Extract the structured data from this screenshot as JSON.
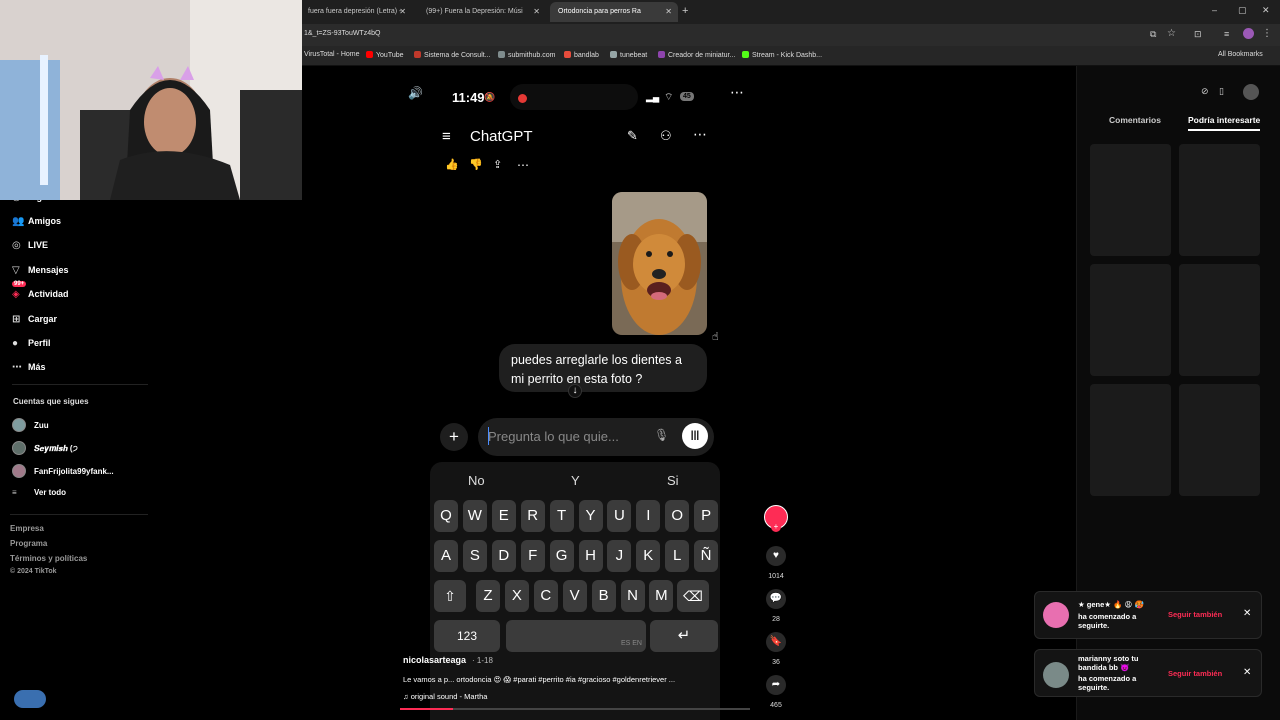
{
  "browser": {
    "tabs": [
      {
        "label": "fuera fuera depresión (Letra) -"
      },
      {
        "label": "(99+) Fuera la Depresión: Músi"
      },
      {
        "label": "Ortodoncia para perros Ra"
      }
    ],
    "url": "1&_t=ZS-93TouWTz4bQ",
    "bookmarks": [
      "VirusTotal - Home",
      "YouTube",
      "Sistema de Consult...",
      "submithub.com",
      "bandlab",
      "tunebeat",
      "Creador de miniatur...",
      "Stream - Kick Dashb..."
    ],
    "all_bookmarks": "All Bookmarks"
  },
  "sidebar": {
    "items": [
      {
        "label": "Siguiendo",
        "icon": "following-icon"
      },
      {
        "label": "Amigos",
        "icon": "friends-icon"
      },
      {
        "label": "LIVE",
        "icon": "live-icon"
      },
      {
        "label": "Mensajes",
        "icon": "messages-icon"
      },
      {
        "label": "Actividad",
        "icon": "activity-icon",
        "badge": "99+"
      },
      {
        "label": "Cargar",
        "icon": "upload-icon"
      },
      {
        "label": "Perfil",
        "icon": "profile-icon"
      },
      {
        "label": "Más",
        "icon": "more-icon"
      }
    ],
    "following_title": "Cuentas que sigues",
    "following": [
      "Zuu",
      "𝑺𝒆𝒚𝒎𝒊𝒔𝒉 (੭",
      "FanFrijolita99yfank..."
    ],
    "see_all": "Ver todo",
    "footer": [
      "Empresa",
      "Programa",
      "Términos y políticas",
      "© 2024 TikTok"
    ]
  },
  "phone": {
    "time": "11:49",
    "battery": "45",
    "app_title": "ChatGPT",
    "message": "puedes arreglarle los dientes a mi perrito en esta foto ?",
    "input_placeholder": "Pregunta lo que quie...",
    "suggestions": [
      "No",
      "Y",
      "Si"
    ],
    "keys_row1": [
      "Q",
      "W",
      "E",
      "R",
      "T",
      "Y",
      "U",
      "I",
      "O",
      "P"
    ],
    "keys_row2": [
      "A",
      "S",
      "D",
      "F",
      "G",
      "H",
      "J",
      "K",
      "L",
      "Ñ"
    ],
    "keys_row3": [
      "Z",
      "X",
      "C",
      "V",
      "B",
      "N",
      "M"
    ],
    "numbers_key": "123",
    "lang": "ES EN"
  },
  "video": {
    "author": "nicolasarteaga",
    "date": "1-18",
    "caption": "Le vamos a p... ortodoncia 😍 😱 #parati #perrito #ia #gracioso #goldenretriever ...",
    "sound": "original sound - Martha",
    "likes": "1014",
    "comments": "28",
    "saves": "36",
    "shares": "465",
    "progress": 0.15
  },
  "right_panel": {
    "tabs": [
      "Comentarios",
      "Podría interesarte"
    ]
  },
  "notifications": [
    {
      "name": "★ gene★ 🔥 😩 🥵",
      "text": "ha comenzado a seguirte.",
      "action": "Seguir también"
    },
    {
      "name": "marianny soto tu bandida bb 👿",
      "text": "ha comenzado a seguirte.",
      "action": "Seguir también"
    }
  ],
  "colors": {
    "accent": "#fe2c55",
    "recording": "#e53935"
  }
}
